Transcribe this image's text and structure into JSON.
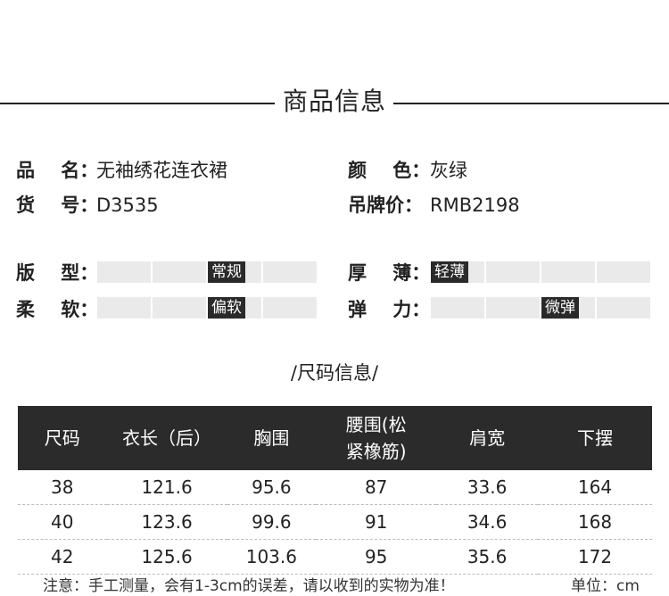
{
  "section_title": "商品信息",
  "product": {
    "name_label": "品    名：",
    "name_value": "无袖绣花连衣裙",
    "sku_label": "货    号：",
    "sku_value": "D3535",
    "color_label": "颜    色：",
    "color_value": "灰绿",
    "price_label": "吊牌价：",
    "price_value": "RMB2198"
  },
  "attributes": {
    "fit_label": "版    型：",
    "fit_value": "常规",
    "fit_level": 3,
    "softness_label": "柔    软：",
    "softness_value": "偏软",
    "softness_level": 3,
    "thickness_label": "厚    薄：",
    "thickness_value": "轻薄",
    "thickness_level": 1,
    "stretch_label": "弹    力：",
    "stretch_value": "微弹",
    "stretch_level": 3,
    "segments": 4,
    "mark_color": "#2a2a2a",
    "track_color": "#eaeaea"
  },
  "size_section_title": "/尺码信息/",
  "size_table": {
    "headers": [
      "尺码",
      "衣长（后）",
      "胸围",
      "腰围(松紧橡筋)",
      "肩宽",
      "下摆"
    ],
    "rows": [
      [
        "38",
        "121.6",
        "95.6",
        "87",
        "33.6",
        "164"
      ],
      [
        "40",
        "123.6",
        "99.6",
        "91",
        "34.6",
        "168"
      ],
      [
        "42",
        "125.6",
        "103.6",
        "95",
        "35.6",
        "172"
      ]
    ],
    "header_bg": "#2b2b2b"
  },
  "note": "注意：手工测量，会有1-3cm的误差，请以收到的实物为准！",
  "unit": "单位：cm"
}
